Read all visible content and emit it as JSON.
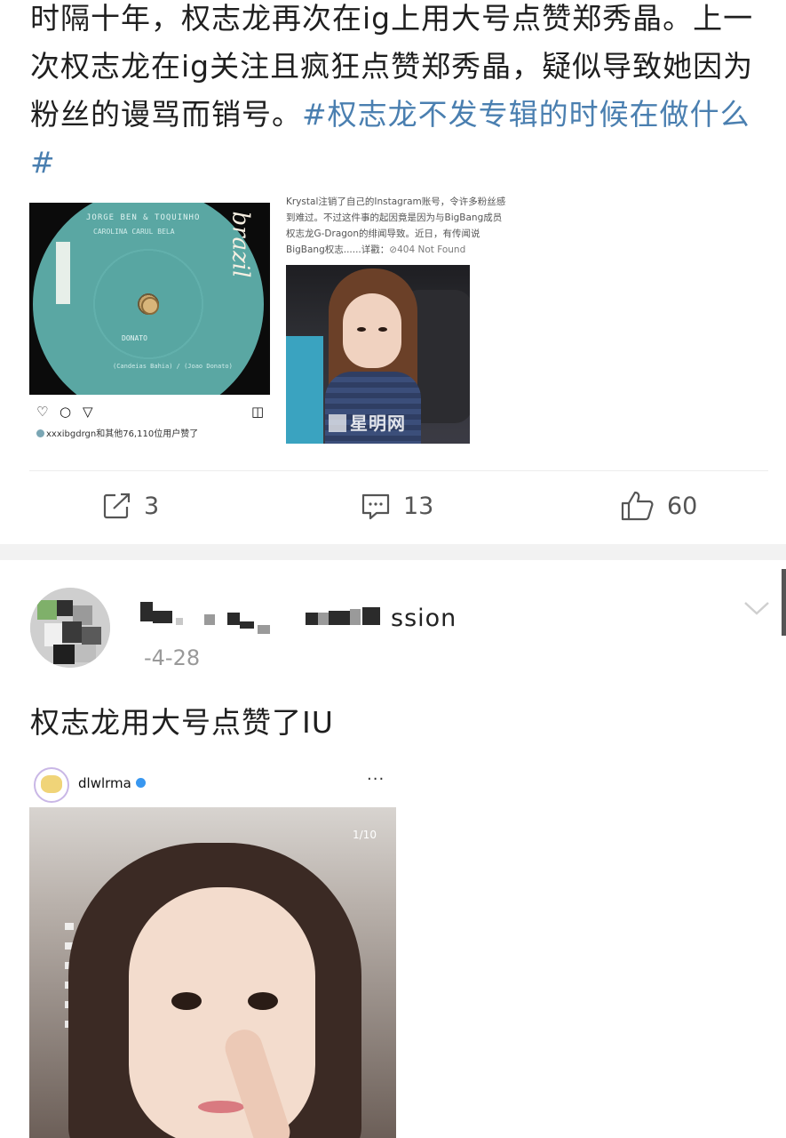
{
  "post1": {
    "text_main": "时隔十年，权志龙再次在ig上用大号点赞郑秀晶。上一次权志龙在ig关注且疯狂点赞郑秀晶，疑似导致她因为粉丝的谩骂而销号。",
    "hashtag": "#权志龙不发专辑的时候在做什么#",
    "ig_card": {
      "record_top": "JORGE BEN & TOQUINHO",
      "record_sub": "CAROLINA CARUL BELA",
      "record_logo": "brazil",
      "record_label": "DONATO",
      "record_label2": "(Candeias Bahia) / (Joao Donato)",
      "likes_user": "xxxibgdrgn",
      "likes_text": "和其他76,110位用户赞了"
    },
    "news_card": {
      "text": "Krystal注销了自己的Instagram账号，令许多粉丝感到难过。不过这件事的起因竟是因为与BigBang成员权志龙G-Dragon的绯闻导致。近日，有传闻说BigBang权志......详戳：",
      "link": "⊘404 Not Found",
      "watermark": "星明网"
    },
    "actions": {
      "repost_count": "3",
      "comment_count": "13",
      "like_count": "60"
    }
  },
  "post2": {
    "username_tail": "ssion",
    "date": "-4-28",
    "text": "权志龙用大号点赞了IU",
    "ig": {
      "username": "dlwlrma",
      "more": "···",
      "counter": "1/10"
    }
  },
  "icons": {
    "repost": "repost-icon",
    "comment": "comment-icon",
    "like": "thumbs-up-icon",
    "chevron": "chevron-down-icon"
  },
  "colors": {
    "hashtag": "#4a7fb0",
    "separator": "#f2f2f2",
    "date": "#999999"
  }
}
